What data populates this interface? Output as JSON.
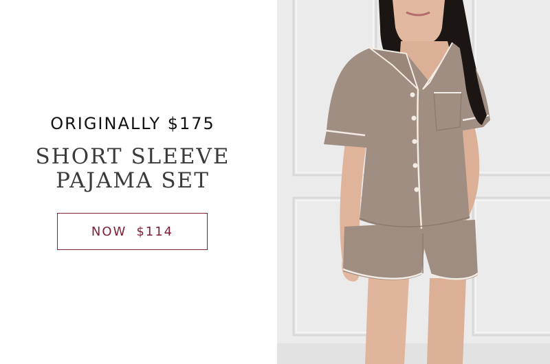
{
  "promo": {
    "eyebrow": "ORIGINALLY $175",
    "title_line1": "SHORT SLEEVE",
    "title_line2": "PAJAMA SET",
    "cta_prefix": "NOW",
    "cta_price": "$114"
  },
  "colors": {
    "accent": "#7d1f33",
    "fabric": "#a08d82",
    "piping": "#f3ece4",
    "wall": "#e9e9ea"
  }
}
